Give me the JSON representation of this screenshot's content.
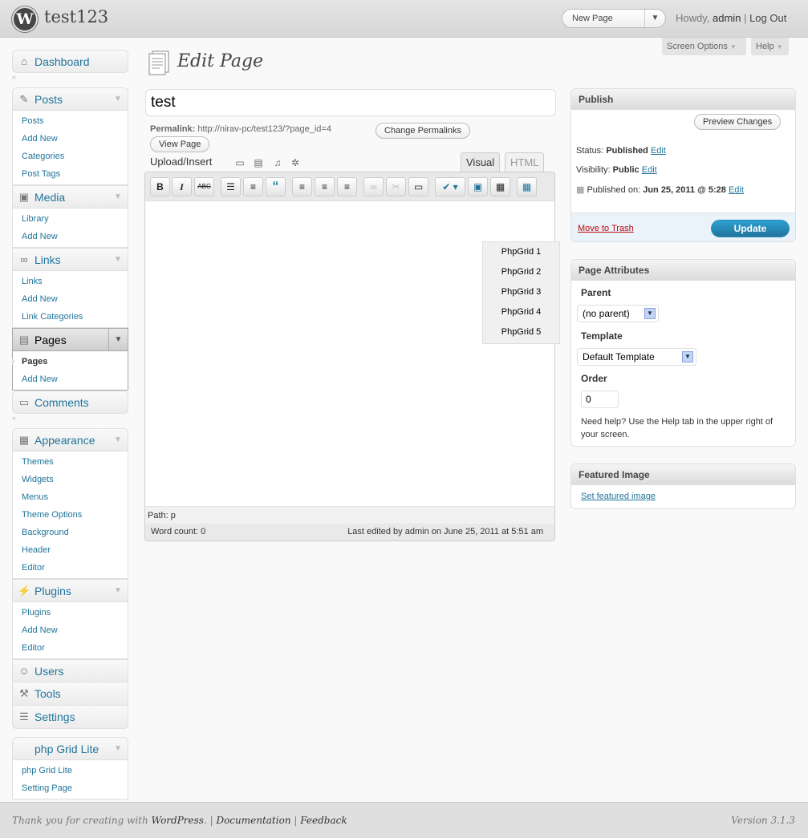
{
  "header": {
    "site_title": "test123",
    "favorite_action": "New Page",
    "howdy": "Howdy,",
    "username": "admin",
    "separator": "|",
    "logout": "Log Out"
  },
  "screen_meta": {
    "screen_options": "Screen Options",
    "help": "Help"
  },
  "menu": {
    "dashboard": "Dashboard",
    "posts": {
      "label": "Posts",
      "items": [
        "Posts",
        "Add New",
        "Categories",
        "Post Tags"
      ]
    },
    "media": {
      "label": "Media",
      "items": [
        "Library",
        "Add New"
      ]
    },
    "links": {
      "label": "Links",
      "items": [
        "Links",
        "Add New",
        "Link Categories"
      ]
    },
    "pages": {
      "label": "Pages",
      "items": [
        "Pages",
        "Add New"
      ]
    },
    "comments": "Comments",
    "appearance": {
      "label": "Appearance",
      "items": [
        "Themes",
        "Widgets",
        "Menus",
        "Theme Options",
        "Background",
        "Header",
        "Editor"
      ]
    },
    "plugins": {
      "label": "Plugins",
      "items": [
        "Plugins",
        "Add New",
        "Editor"
      ]
    },
    "users": "Users",
    "tools": "Tools",
    "settings": "Settings",
    "phpgrid": {
      "label": "php Grid Lite",
      "items": [
        "php Grid Lite",
        "Setting Page"
      ]
    }
  },
  "main": {
    "heading": "Edit Page",
    "title_value": "test",
    "permalink_label": "Permalink:",
    "permalink_url": "http://nirav-pc/test123/?page_id=4",
    "change_permalinks": "Change Permalinks",
    "view_page": "View Page",
    "upload_insert": "Upload/Insert",
    "tab_visual": "Visual",
    "tab_html": "HTML",
    "grid_menu": [
      "PhpGrid 1",
      "PhpGrid 2",
      "PhpGrid 3",
      "PhpGrid 4",
      "PhpGrid 5"
    ],
    "path": "Path: p",
    "word_count": "Word count: 0",
    "last_edited": "Last edited by admin on June 25, 2011 at 5:51 am"
  },
  "publish": {
    "title": "Publish",
    "preview": "Preview Changes",
    "status_label": "Status:",
    "status_value": "Published",
    "visibility_label": "Visibility:",
    "visibility_value": "Public",
    "published_label": "Published on:",
    "published_value": "Jun 25, 2011 @ 5:28",
    "edit": "Edit",
    "trash": "Move to Trash",
    "update": "Update"
  },
  "attributes": {
    "title": "Page Attributes",
    "parent_label": "Parent",
    "parent_value": "(no parent)",
    "template_label": "Template",
    "template_value": "Default Template",
    "order_label": "Order",
    "order_value": "0",
    "help": "Need help? Use the Help tab in the upper right of your screen."
  },
  "featured": {
    "title": "Featured Image",
    "link": "Set featured image"
  },
  "footer": {
    "thanks_prefix": "Thank you for creating with",
    "wordpress": "WordPress",
    "documentation": "Documentation",
    "feedback": "Feedback",
    "version": "Version 3.1.3"
  }
}
